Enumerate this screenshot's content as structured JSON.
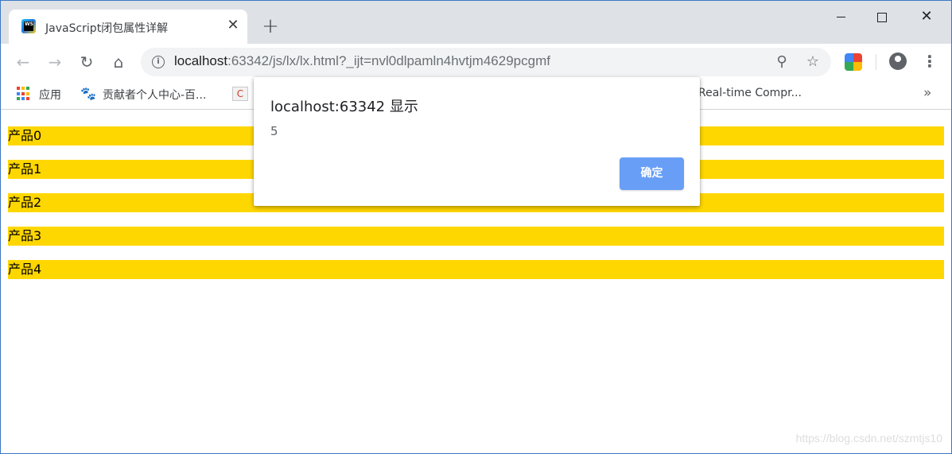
{
  "tab": {
    "favicon": "webstorm-icon",
    "favicon_text": "WS",
    "title": "JavaScript闭包属性详解",
    "close_glyph": "✕"
  },
  "newtab_glyph": "+",
  "window_controls": {
    "close_glyph": "✕"
  },
  "nav": {
    "back_glyph": "←",
    "forward_glyph": "→",
    "reload_glyph": "↻",
    "home_glyph": "⌂"
  },
  "address": {
    "info_glyph": "i",
    "host": "localhost",
    "rest": ":63342/js/lx/lx.html?_ijt=nvl0dlpamln4hvtjm4629pcgmf",
    "zoom_glyph": "⚲",
    "star_glyph": "☆"
  },
  "menu_glyph": "⋮",
  "bookmarks": {
    "apps_label": "应用",
    "apps_colors": [
      "#ea4335",
      "#fbbc04",
      "#34a853",
      "#4285f4",
      "#ea4335",
      "#fbbc04",
      "#34a853",
      "#4285f4",
      "#ea4335"
    ],
    "baidu_label": "贡献者个人中心-百...",
    "baidu_glyph": "🐾",
    "csdn_glyph": "C",
    "realtime_label": "Real-time Compr...",
    "more_glyph": "»"
  },
  "products": [
    "产品0",
    "产品1",
    "产品2",
    "产品3",
    "产品4"
  ],
  "product_color": "#ffd700",
  "dialog": {
    "title": "localhost:63342 显示",
    "message": "5",
    "ok_label": "确定"
  },
  "watermark": "https://blog.csdn.net/szmtjs10"
}
